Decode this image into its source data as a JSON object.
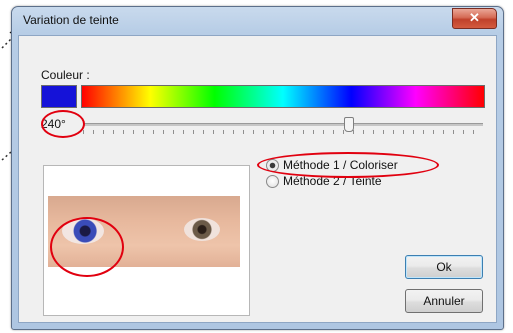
{
  "window": {
    "title": "Variation de teinte",
    "close_symbol": "✕"
  },
  "color": {
    "label": "Couleur :",
    "swatch_color": "#1512d8"
  },
  "hue": {
    "value": "240°"
  },
  "methods": [
    {
      "label": "Méthode 1 / Coloriser",
      "selected": true
    },
    {
      "label": "Méthode 2 / Teinte",
      "selected": false
    }
  ],
  "buttons": {
    "ok": "Ok",
    "cancel": "Annuler"
  },
  "annotation": {
    "color": "#e1000f"
  }
}
